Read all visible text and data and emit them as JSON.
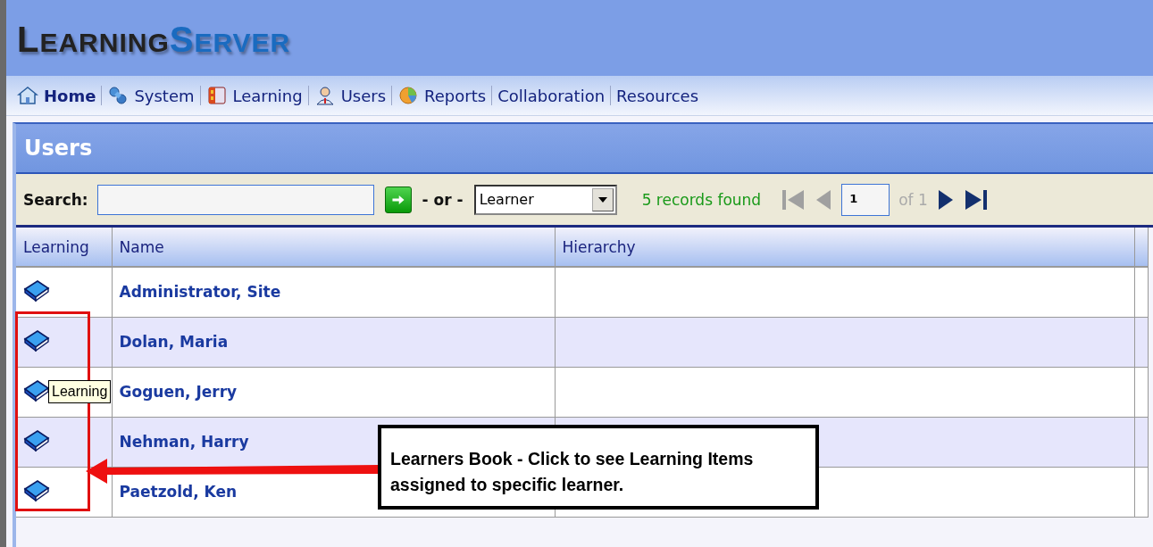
{
  "logo": {
    "first": "LEARNING",
    "second": "SERVER"
  },
  "nav": [
    {
      "label": "Home",
      "kind": "icon-link",
      "selected": true
    },
    {
      "label": "System",
      "kind": "icon-link",
      "selected": false
    },
    {
      "label": "Learning",
      "kind": "icon-link",
      "selected": false
    },
    {
      "label": "Users",
      "kind": "icon-link",
      "selected": false
    },
    {
      "label": "Reports",
      "kind": "icon-link",
      "selected": false
    },
    {
      "label": "Collaboration",
      "kind": "text-link",
      "selected": false
    },
    {
      "label": "Resources",
      "kind": "text-link",
      "selected": false
    }
  ],
  "panel": {
    "title": "Users"
  },
  "search": {
    "label": "Search:",
    "or": "- or -",
    "filter": "Learner",
    "records": "5 records found",
    "pager": {
      "page": "1",
      "of": "of 1",
      "first_disabled": true,
      "prev_disabled": true,
      "next_disabled": false,
      "last_disabled": false
    }
  },
  "table": {
    "columns": [
      "Learning",
      "Name",
      "Hierarchy"
    ],
    "rows": [
      {
        "name": "Administrator, Site"
      },
      {
        "name": "Dolan, Maria"
      },
      {
        "name": "Goguen, Jerry"
      },
      {
        "name": "Nehman, Harry"
      },
      {
        "name": "Paetzold, Ken"
      }
    ]
  },
  "tooltip": {
    "text": "Learning"
  },
  "callout": {
    "text": "Learners Book - Click to see Learning Items assigned to specific learner."
  }
}
